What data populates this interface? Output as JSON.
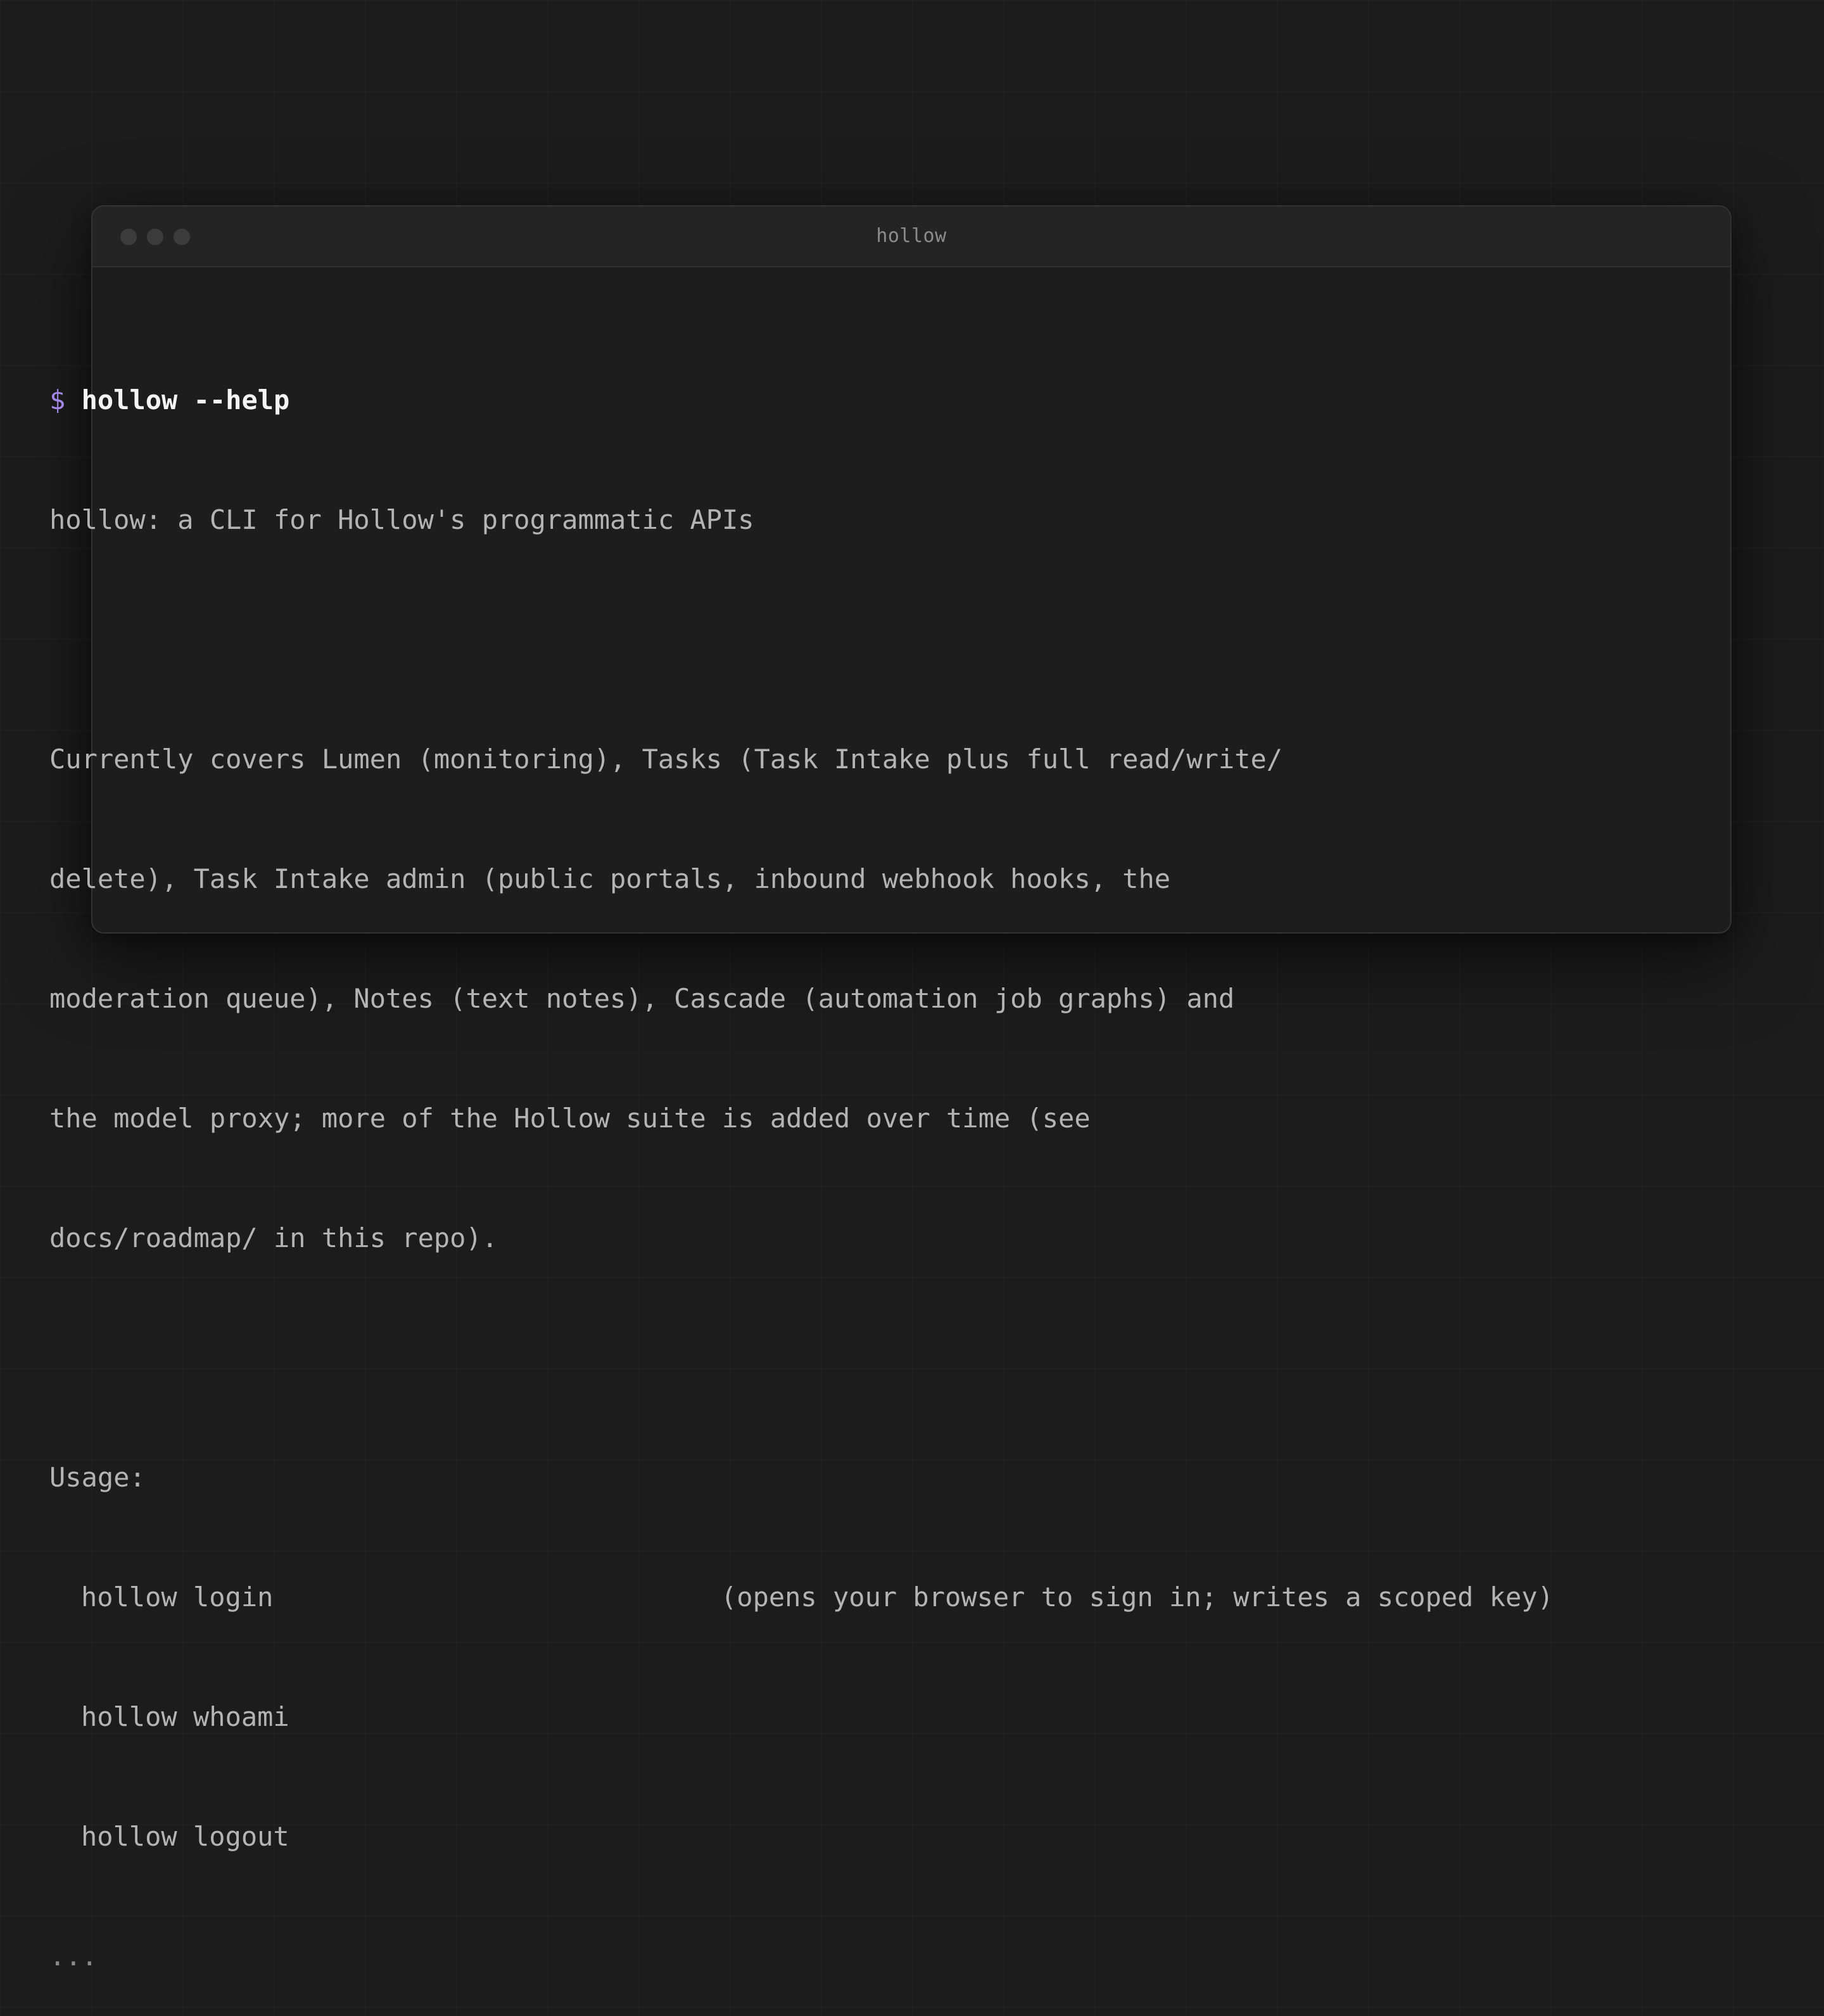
{
  "window": {
    "title": "hollow"
  },
  "terminal": {
    "prompt_symbol": "$",
    "command": "hollow --help",
    "summary": "hollow: a CLI for Hollow's programmatic APIs",
    "description_lines": [
      "Currently covers Lumen (monitoring), Tasks (Task Intake plus full read/write/",
      "delete), Task Intake admin (public portals, inbound webhook hooks, the",
      "moderation queue), Notes (text notes), Cascade (automation job graphs) and",
      "the model proxy; more of the Hollow suite is added over time (see",
      "docs/roadmap/ in this repo)."
    ],
    "usage_heading": "Usage:",
    "usage": [
      {
        "command": "hollow login",
        "description": "(opens your browser to sign in; writes a scoped key)"
      },
      {
        "command": "hollow whoami",
        "description": ""
      },
      {
        "command": "hollow logout",
        "description": ""
      }
    ],
    "ellipsis": "..."
  },
  "colors": {
    "background": "#1c1c1c",
    "window": "#1d1d1d",
    "titlebar": "#242424",
    "prompt_accent": "#a287e6",
    "text": "#b4b4b4",
    "command_text": "#f4f4f4"
  }
}
